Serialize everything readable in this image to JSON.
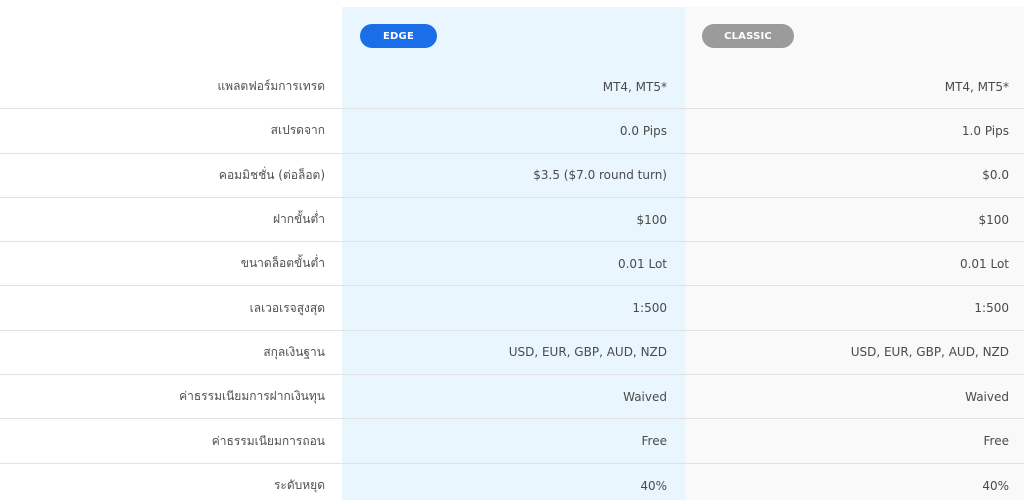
{
  "header": {
    "edge_label": "EDGE",
    "classic_label": "CLASSIC"
  },
  "rows": [
    {
      "label": "แพลตฟอร์มการเทรด",
      "edge": "MT4, MT5*",
      "classic": "MT4, MT5*"
    },
    {
      "label": "สเปรดจาก",
      "edge": "0.0 Pips",
      "classic": "1.0 Pips"
    },
    {
      "label": "คอมมิชชั่น (ต่อล็อต)",
      "edge": "$3.5 ($7.0 round turn)",
      "classic": "$0.0"
    },
    {
      "label": "ฝากขั้นต่ำ",
      "edge": "$100",
      "classic": "$100"
    },
    {
      "label": "ขนาดล็อตขั้นต่ำ",
      "edge": "0.01 Lot",
      "classic": "0.01 Lot"
    },
    {
      "label": "เลเวอเรจสูงสุด",
      "edge": "1:500",
      "classic": "1:500"
    },
    {
      "label": "สกุลเงินฐาน",
      "edge": "USD, EUR, GBP, AUD, NZD",
      "classic": "USD, EUR, GBP, AUD, NZD"
    },
    {
      "label": "ค่าธรรมเนียมการฝากเงินทุน",
      "edge": "Waived",
      "classic": "Waived"
    },
    {
      "label": "ค่าธรรมเนียมการถอน",
      "edge": "Free",
      "classic": "Free"
    },
    {
      "label": "ระดับหยุด",
      "edge": "40%",
      "classic": "40%"
    }
  ],
  "colors": {
    "edge_badge": "#1a6fe8",
    "classic_badge": "#9b9b9b",
    "edge_column_bg": "#eaf6fd",
    "classic_column_bg": "#f9f9f9"
  }
}
